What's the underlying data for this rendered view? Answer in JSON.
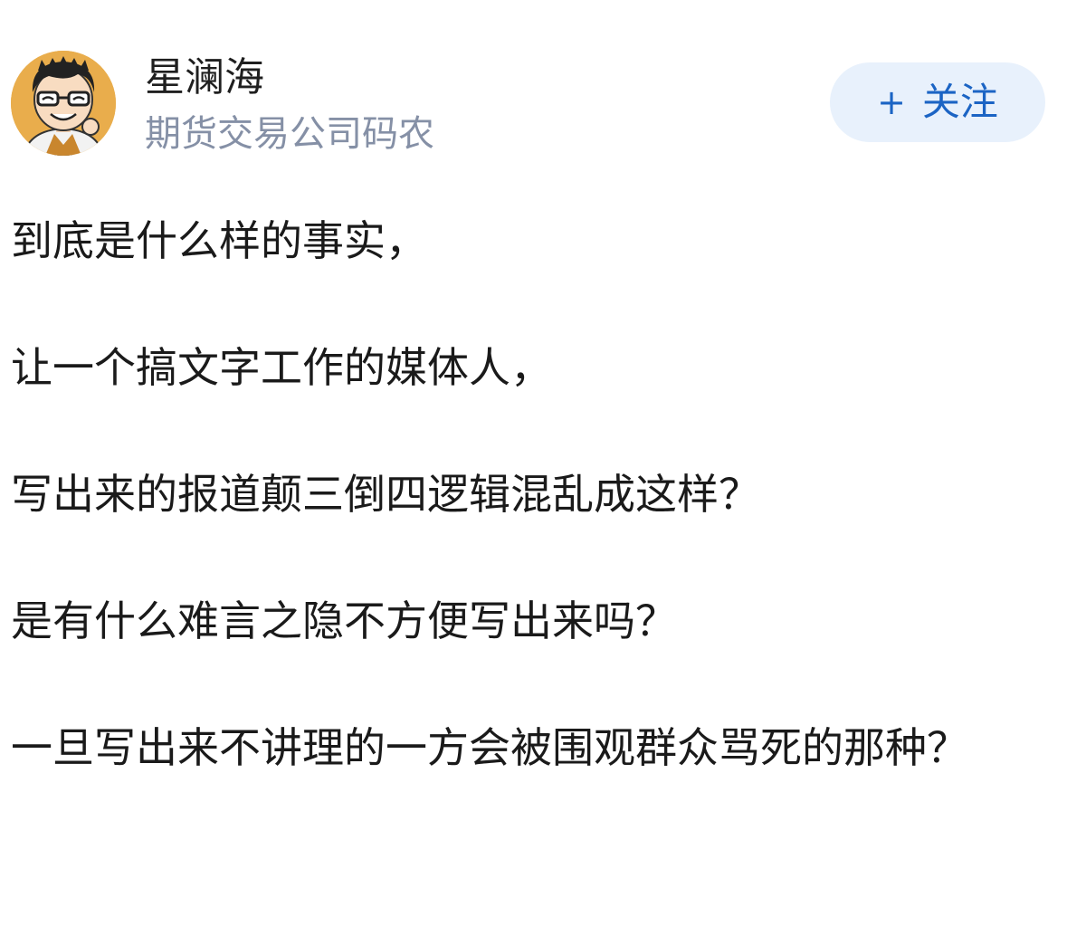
{
  "author": {
    "name": "星澜海",
    "subtitle": "期货交易公司码农",
    "avatar_icon": "cartoon-avatar-icon"
  },
  "follow_button": {
    "icon": "plus-icon",
    "plus_symbol": "+",
    "label": "关注"
  },
  "colors": {
    "name_text": "#1f1f1f",
    "subtitle_text": "#8590a6",
    "follow_bg": "#e8f1fc",
    "follow_text": "#1b64c4",
    "body_text": "#1a1a1a"
  },
  "post": {
    "paragraphs": [
      "到底是什么样的事实，",
      "让一个搞文字工作的媒体人，",
      "写出来的报道颠三倒四逻辑混乱成这样？",
      "是有什么难言之隐不方便写出来吗？",
      "一旦写出来不讲理的一方会被围观群众骂死的那种？"
    ]
  }
}
